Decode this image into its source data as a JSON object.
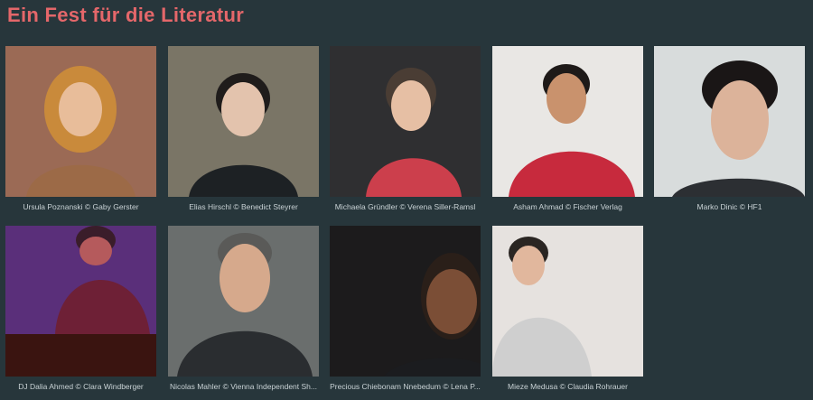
{
  "page": {
    "title": "Ein Fest für die Literatur"
  },
  "authors": [
    {
      "caption": "Ursula Poznanski © Gaby Gerster",
      "bg": "#9b6a55",
      "hair": "#c98a3b",
      "skin": "#e8bd9a",
      "top": "#9c6a47"
    },
    {
      "caption": "Elias Hirschl © Benedict Steyrer",
      "bg": "#7a7566",
      "hair": "#1f1c1b",
      "skin": "#e3c3ad",
      "top": "#1d2124"
    },
    {
      "caption": "Michaela Gründler © Verena Siller-Ramsl",
      "bg": "#2f2f31",
      "hair": "#4a3d34",
      "skin": "#e6bfa4",
      "top": "#cc3f4c"
    },
    {
      "caption": "Asham Ahmad © Fischer Verlag",
      "bg": "#e9e7e4",
      "hair": "#1e1a18",
      "skin": "#c9926d",
      "top": "#c72a3d"
    },
    {
      "caption": "Marko Dinic © HF1",
      "bg": "#d8dcdc",
      "hair": "#1a1616",
      "skin": "#dcb39a",
      "top": "#2c2f33"
    },
    {
      "caption": "DJ Dalia Ahmed © Clara Windberger",
      "bg": "#5a2f7a",
      "hair": "#3a1d2a",
      "skin": "#b55a5c",
      "top": "#6e2036"
    },
    {
      "caption": "Nicolas Mahler © Vienna Independent Sh...",
      "bg": "#6a6e6d",
      "hair": "#5a5a58",
      "skin": "#d6a98c",
      "top": "#2a2d30"
    },
    {
      "caption": "Precious Chiebonam Nnebedum © Lena P...",
      "bg": "#1c1b1c",
      "hair": "#2a1f19",
      "skin": "#7b4e36",
      "top": "#1b1c1f"
    },
    {
      "caption": "Mieze Medusa © Claudia Rohrauer",
      "bg": "#e6e2df",
      "hair": "#2a2522",
      "skin": "#e1b79d",
      "top": "#cfcfcf"
    }
  ]
}
